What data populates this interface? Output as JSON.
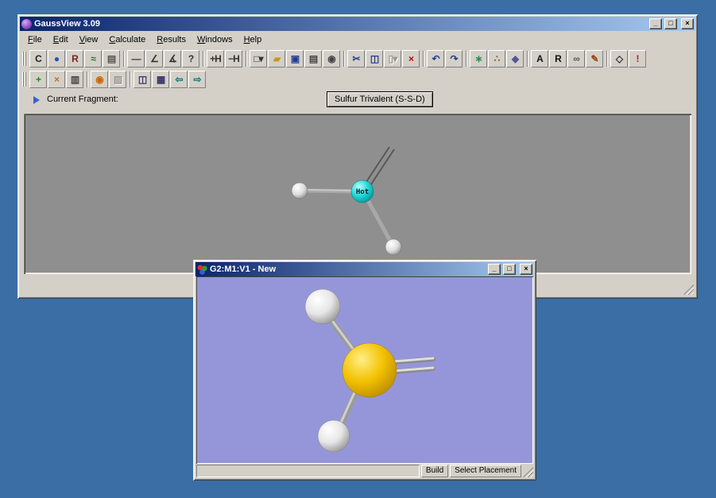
{
  "colors": {
    "desktop_bg": "#3A6EA5",
    "chrome": "#D4D0C8",
    "view_bg": "#8F8F8F",
    "model_bg": "#9596DA",
    "title_l": "#0A246A",
    "title_r": "#A6CAF0",
    "sulfur_atom": "#F0C000",
    "hydrogen_atom": "#E8E8E8",
    "hot_atom": "#00C8C8"
  },
  "controls": {
    "minimize": "_",
    "maximize": "□",
    "close": "×"
  },
  "main_window": {
    "title": "GaussView 3.09",
    "menu_items": [
      {
        "name": "menu-file",
        "label": "File"
      },
      {
        "name": "menu-edit",
        "label": "Edit"
      },
      {
        "name": "menu-view",
        "label": "View"
      },
      {
        "name": "menu-calculate",
        "label": "Calculate"
      },
      {
        "name": "menu-results",
        "label": "Results"
      },
      {
        "name": "menu-windows",
        "label": "Windows"
      },
      {
        "name": "menu-help",
        "label": "Help"
      }
    ],
    "toolbar_row1": [
      {
        "name": "element-fragment-icon",
        "label": "C",
        "color": "#222222"
      },
      {
        "name": "ring-fragment-icon",
        "label": "●",
        "color": "#2A52BE"
      },
      {
        "name": "r-group-fragment-icon",
        "label": "R",
        "color": "#7A1F1F"
      },
      {
        "name": "biological-fragment-icon",
        "label": "≈",
        "color": "#1F7A2F"
      },
      {
        "name": "custom-fragment-icon",
        "label": "▤",
        "color": "#555555"
      },
      {
        "type": "sep"
      },
      {
        "name": "modify-bond-icon",
        "label": "―",
        "color": "#333333"
      },
      {
        "name": "modify-angle-icon",
        "label": "∠",
        "color": "#333333"
      },
      {
        "name": "modify-dihedral-icon",
        "label": "∡",
        "color": "#333333"
      },
      {
        "name": "inquire-icon",
        "label": "?",
        "color": "#333333"
      },
      {
        "type": "sep"
      },
      {
        "name": "add-valence-icon",
        "label": "+H",
        "color": "#333333"
      },
      {
        "name": "delete-atom-icon",
        "label": "−H",
        "color": "#333333"
      },
      {
        "type": "sep"
      },
      {
        "name": "new-file-icon",
        "label": "□▾",
        "color": "#333333"
      },
      {
        "name": "open-file-icon",
        "label": "▰",
        "color": "#C8961E"
      },
      {
        "name": "save-file-icon",
        "label": "▣",
        "color": "#1F3D8F"
      },
      {
        "name": "print-icon",
        "label": "▤",
        "color": "#444444"
      },
      {
        "name": "capture-image-icon",
        "label": "◉",
        "color": "#444444"
      },
      {
        "type": "sep"
      },
      {
        "name": "cut-icon",
        "label": "✂",
        "color": "#1F3D8F"
      },
      {
        "name": "copy-icon",
        "label": "◫",
        "color": "#1F3D8F"
      },
      {
        "name": "paste-icon",
        "label": "▯▾",
        "disabled": true
      },
      {
        "name": "delete-icon",
        "label": "×",
        "color": "#C00000"
      },
      {
        "type": "sep"
      },
      {
        "name": "undo-icon",
        "label": "↶",
        "color": "#1F3D8F"
      },
      {
        "name": "redo-icon",
        "label": "↷",
        "color": "#1F3D8F"
      },
      {
        "type": "sep"
      },
      {
        "name": "clean-structure-icon",
        "label": "∗",
        "color": "#2E8B57"
      },
      {
        "name": "rebond-icon",
        "label": "∴",
        "color": "#8A5A2E"
      },
      {
        "name": "symmetrize-icon",
        "label": "◆",
        "color": "#555599"
      },
      {
        "type": "sep"
      },
      {
        "name": "atom-labels-icon",
        "label": "A",
        "color": "#111111"
      },
      {
        "name": "residue-labels-icon",
        "label": "R",
        "color": "#111111"
      },
      {
        "name": "link-icon",
        "label": "∞",
        "color": "#555555"
      },
      {
        "name": "highlight-pen-icon",
        "label": "✎",
        "color": "#994411"
      },
      {
        "type": "sep"
      },
      {
        "name": "display-format-icon",
        "label": "◇",
        "color": "#333333"
      },
      {
        "name": "status-indicator-icon",
        "label": "!",
        "color": "#B02020"
      }
    ],
    "toolbar_row2": [
      {
        "name": "add-fragment-icon",
        "label": "+",
        "color": "#1A8A1A"
      },
      {
        "name": "atom-selection-icon",
        "label": "×",
        "color": "#B87333"
      },
      {
        "name": "builder-panel-icon",
        "label": "▥",
        "color": "#444444"
      },
      {
        "type": "sep"
      },
      {
        "name": "recenter-view-icon",
        "label": "◉",
        "color": "#CC6600"
      },
      {
        "name": "capture-disabled-icon",
        "label": "▨",
        "disabled": true
      },
      {
        "type": "sep"
      },
      {
        "name": "cascade-windows-icon",
        "label": "◫",
        "color": "#333366"
      },
      {
        "name": "tile-windows-icon",
        "label": "▦",
        "color": "#333366"
      },
      {
        "name": "back-icon",
        "label": "⇦",
        "color": "#007878"
      },
      {
        "name": "forward-icon",
        "label": "⇨",
        "color": "#007878"
      }
    ],
    "fragment_bar": {
      "label": "Current Fragment:",
      "button": "Sulfur Trivalent (S-S-D)"
    },
    "view": {
      "hot_atom_label": "Hot"
    }
  },
  "child_window": {
    "title": "G2:M1:V1 - New",
    "status": {
      "message": "",
      "build": "Build",
      "placement": "Select Placement"
    }
  }
}
